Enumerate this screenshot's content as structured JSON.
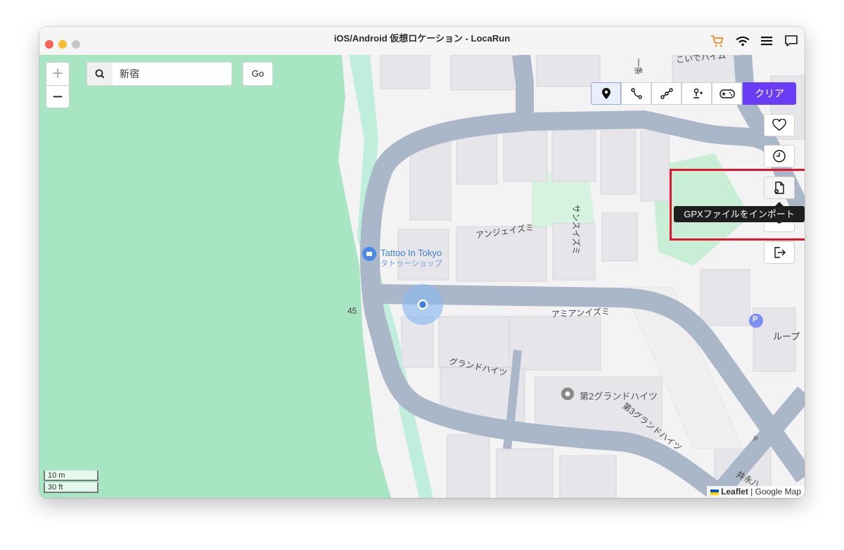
{
  "window": {
    "title": "iOS/Android 仮想ロケーション - LocaRun"
  },
  "titlebar_icons": [
    "cart-icon",
    "wifi-icon",
    "menu-icon",
    "chat-icon"
  ],
  "zoom": {
    "in": "+",
    "out": "−"
  },
  "search": {
    "value": "新宿",
    "go_label": "Go"
  },
  "modes": [
    {
      "name": "teleport-mode",
      "icon": "pin-icon",
      "active": true
    },
    {
      "name": "two-spot-mode",
      "icon": "route-icon",
      "active": false
    },
    {
      "name": "multi-spot-mode",
      "icon": "multi-route-icon",
      "active": false
    },
    {
      "name": "joystick-mode",
      "icon": "joystick-icon",
      "active": false
    },
    {
      "name": "gamepad-mode",
      "icon": "gamepad-icon",
      "active": false
    }
  ],
  "clear_label": "クリア",
  "side_buttons": [
    "heart-icon",
    "history-icon",
    "import-file-icon",
    "settings-icon",
    "export-icon"
  ],
  "tooltip": "GPXファイルをインポート",
  "map_labels": {
    "poi_name": "Tattoo In Tokyo",
    "poi_sub": "タトゥーショップ",
    "road_number": "45",
    "building1": "アンジェイズミ",
    "building2": "サンスイズミ",
    "building3": "アミアンイズミ",
    "building4": "グランドハイツ",
    "building5": "第2グランドハイツ",
    "building6": "第3グランドハイツ",
    "building7": "こいでハイム",
    "building8": "ループ",
    "building9": "一条",
    "parking": "P",
    "corner_text": "井永八"
  },
  "scale": {
    "metric": "10 m",
    "imperial": "30 ft"
  },
  "attribution": {
    "leaflet": "Leaflet",
    "separator": " | ",
    "provider": "Google Map"
  },
  "colors": {
    "accent": "#6a3cf5",
    "highlight": "#e2142d",
    "park": "#a8e6c3",
    "road": "#aab7c9"
  }
}
